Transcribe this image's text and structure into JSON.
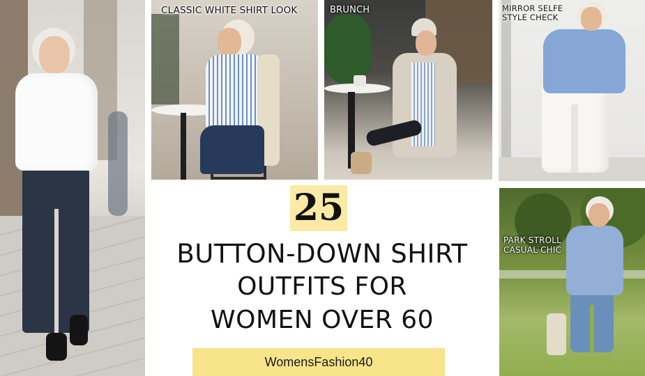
{
  "captions": {
    "classic": "CLASSIC WHITE SHIRT LOOK",
    "brunch": "BRUNCH",
    "mirror_line1": "MIRROR SELFE",
    "mirror_line2": "STYLE CHECK",
    "park_line1": "PARK STROLL",
    "park_line2": "CASUAL CHIC"
  },
  "title": {
    "number": "25",
    "line1": "BUTTON-DOWN SHIRT",
    "line2": "OUTFITS FOR",
    "line3": "WOMEN OVER 60"
  },
  "site": "WomensFashion40",
  "colors": {
    "highlight": "#fbe9a6",
    "badge": "#f8e48a",
    "text": "#111111"
  }
}
